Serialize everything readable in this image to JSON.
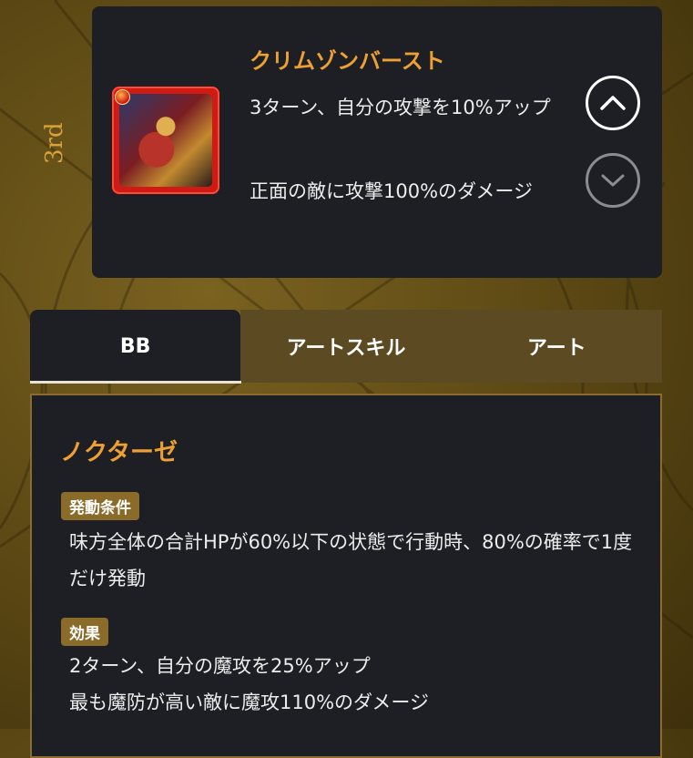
{
  "rank": "3rd",
  "skill": {
    "title": "クリムゾンバースト",
    "effect1": "3ターン、自分の攻撃を10%アップ",
    "effect2": "正面の敵に攻撃100%のダメージ"
  },
  "icons": {
    "up": "chevron-up-icon",
    "down": "chevron-down-icon"
  },
  "tabs": [
    "BB",
    "アートスキル",
    "アート"
  ],
  "bb": {
    "name": "ノクターゼ",
    "condition_label": "発動条件",
    "condition": "味方全体の合計HPが60%以下の状態で行動時、80%の確率で1度だけ発動",
    "effect_label": "効果",
    "effect1": "2ターン、自分の魔攻を25%アップ",
    "effect2": "最も魔防が高い敵に魔攻110%のダメージ"
  },
  "colors": {
    "accent": "#eea032",
    "card": "#1d1f24",
    "tab_inactive": "#5c4a22",
    "badge": "#8a6b2a"
  }
}
